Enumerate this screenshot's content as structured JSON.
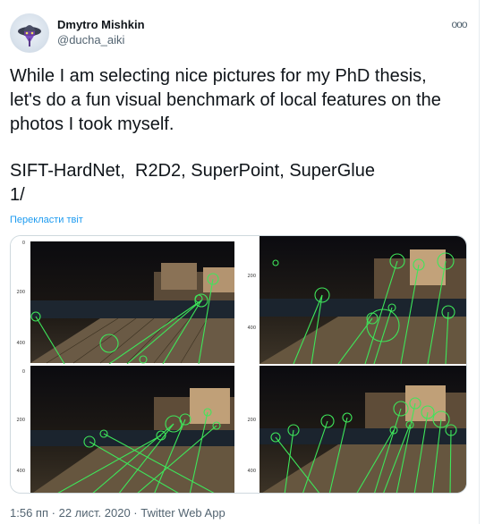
{
  "author": {
    "display_name": "Dmytro Mishkin",
    "handle": "@ducha_aiki",
    "avatar_icon": "avatar-hat-icon"
  },
  "menu": {
    "more_label": "ooo"
  },
  "tweet": {
    "paragraphs": [
      [
        "While I am selecting nice pictures for my PhD thesis,",
        "let's do a fun visual benchmark of local features on the",
        "photos I took myself."
      ],
      [
        "SIFT-HardNet,  R2D2, SuperPoint, SuperGlue",
        "1/"
      ]
    ]
  },
  "translate_label": "Перекласти твіт",
  "media": {
    "images": [
      {
        "name": "SIFT-HardNet matches",
        "y_ticks": [
          "0",
          "200",
          "400"
        ]
      },
      {
        "name": "R2D2 matches",
        "y_ticks": [
          "200",
          "400"
        ]
      },
      {
        "name": "SuperPoint matches",
        "y_ticks": [
          "0",
          "200",
          "400"
        ]
      },
      {
        "name": "SuperGlue matches",
        "y_ticks": [
          "200",
          "400"
        ]
      }
    ],
    "match_color": "#3ee65a"
  },
  "meta": {
    "time": "1:56 пп",
    "separator": "·",
    "date": "22 лист. 2020",
    "source": "Twitter Web App"
  }
}
